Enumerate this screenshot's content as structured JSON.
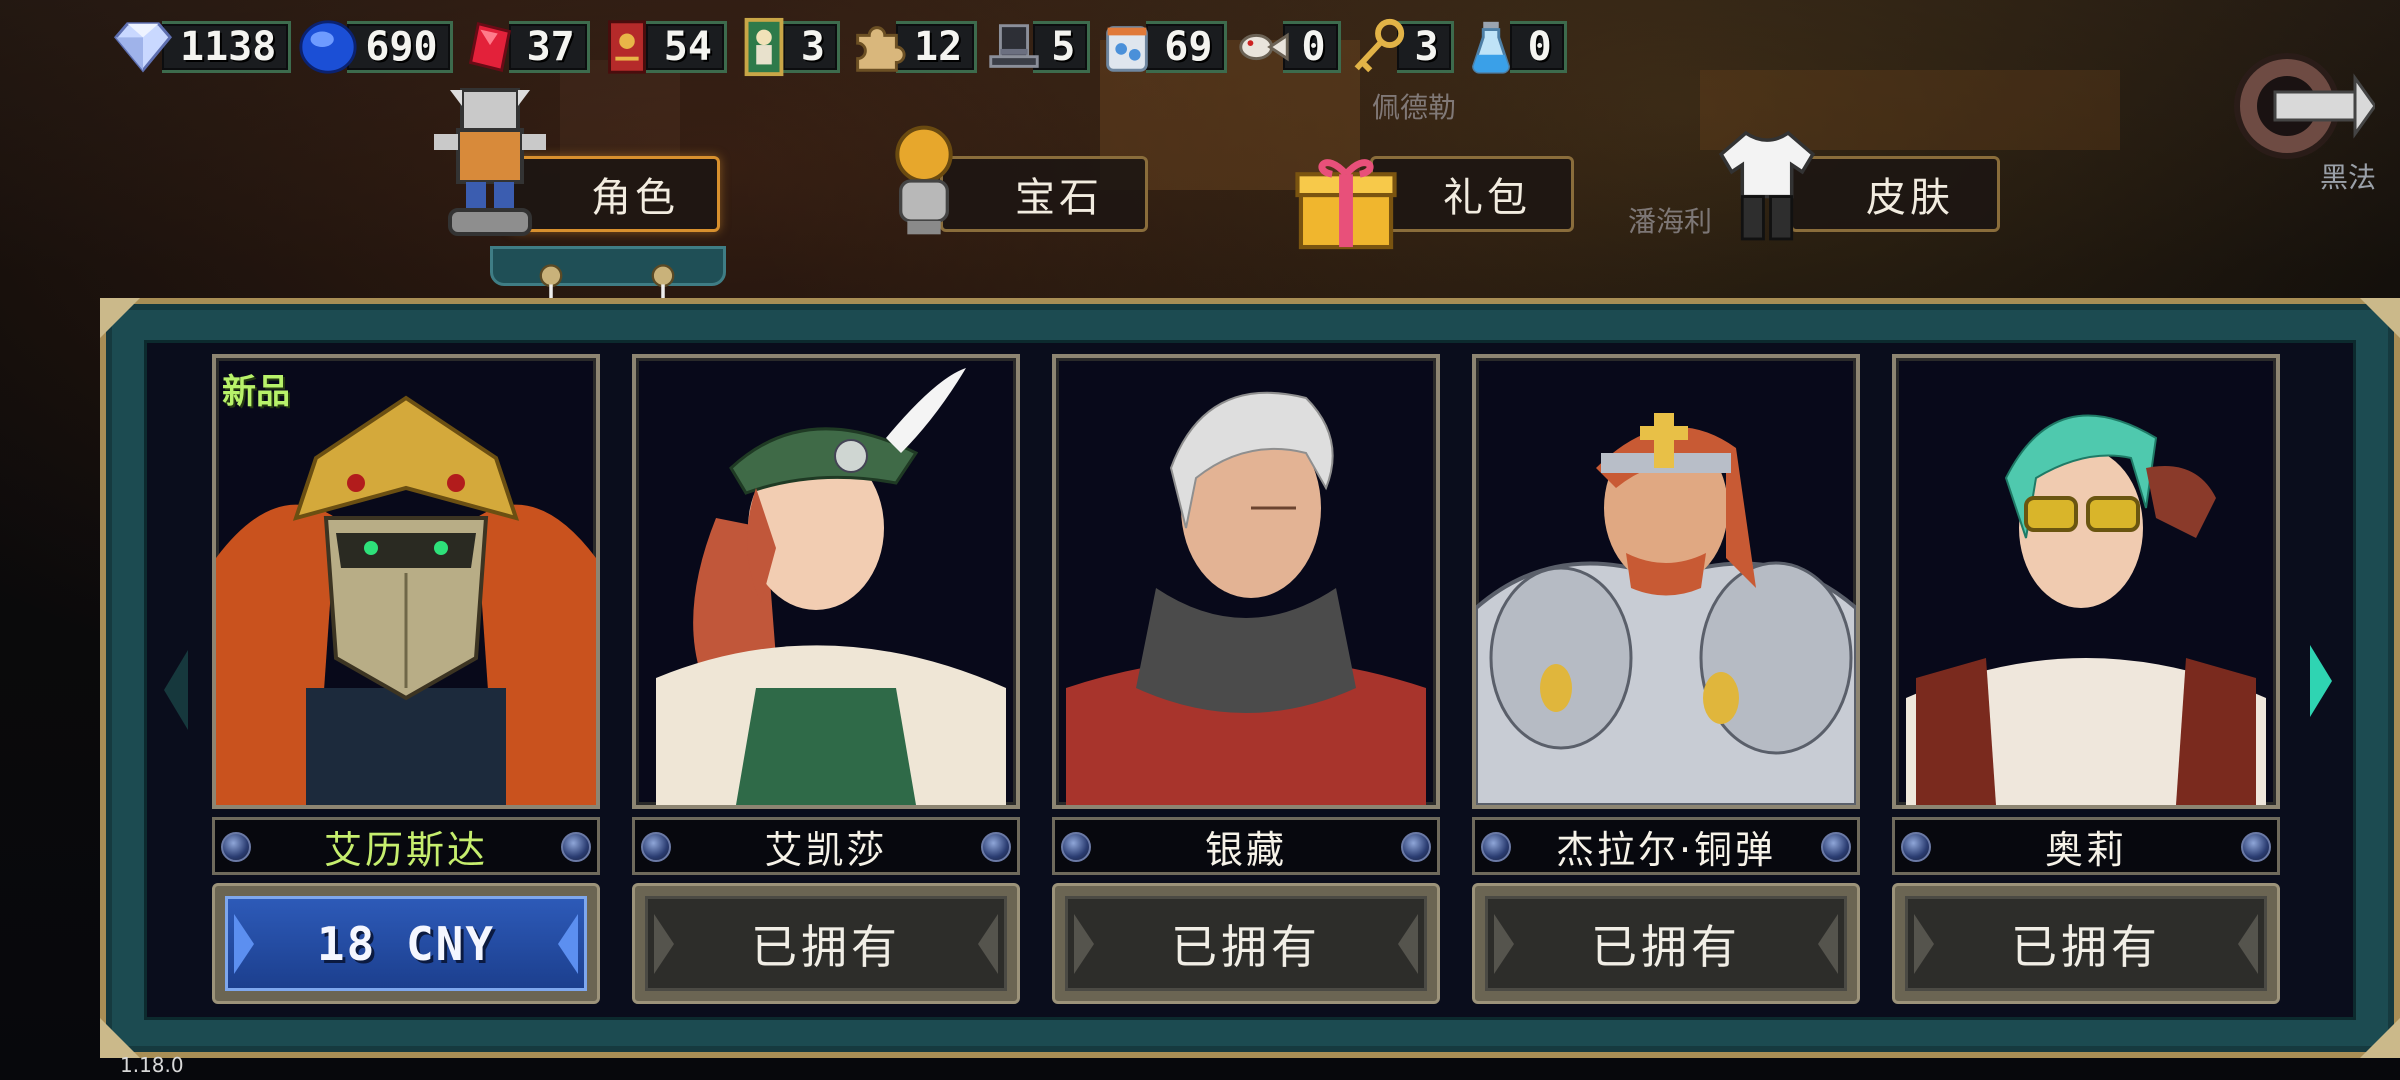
{
  "currencies": [
    {
      "icon": "diamond-icon",
      "value": "1138"
    },
    {
      "icon": "blue-gem-icon",
      "value": "690"
    },
    {
      "icon": "red-gem-icon",
      "value": "37"
    },
    {
      "icon": "red-book-icon",
      "value": "54"
    },
    {
      "icon": "tarot-card-icon",
      "value": "3"
    },
    {
      "icon": "puzzle-piece-icon",
      "value": "12"
    },
    {
      "icon": "top-hat-icon",
      "value": "5"
    },
    {
      "icon": "food-bag-icon",
      "value": "69"
    },
    {
      "icon": "fish-skeleton-icon",
      "value": "0"
    },
    {
      "icon": "gold-key-icon",
      "value": "3"
    },
    {
      "icon": "potion-vial-icon",
      "value": "0"
    }
  ],
  "tabs": [
    {
      "label": "角色",
      "icon": "knight-character-icon",
      "active": true
    },
    {
      "label": "宝石",
      "icon": "gem-hand-icon",
      "active": false
    },
    {
      "label": "礼包",
      "icon": "gift-box-icon",
      "active": false
    },
    {
      "label": "皮肤",
      "icon": "shirt-icon",
      "active": false
    }
  ],
  "background_labels": {
    "top": "佩德勒",
    "middle": "潘海利",
    "right": "黑法"
  },
  "characters": [
    {
      "name": "艾历斯达",
      "button": "18 CNY",
      "new_badge": "新品",
      "owned": false
    },
    {
      "name": "艾凯莎",
      "button": "已拥有",
      "owned": true
    },
    {
      "name": "银藏",
      "button": "已拥有",
      "owned": true
    },
    {
      "name": "杰拉尔·铜弹",
      "button": "已拥有",
      "owned": true
    },
    {
      "name": "奥莉",
      "button": "已拥有",
      "owned": true
    }
  ],
  "version": "1.18.0",
  "colors": {
    "panel_teal": "#1c4b51",
    "panel_gold_border": "#a98e55",
    "buy_button_blue": "#2d5ab8",
    "new_highlight_green": "#c6ee6e",
    "active_tab_orange": "#d8902e"
  }
}
